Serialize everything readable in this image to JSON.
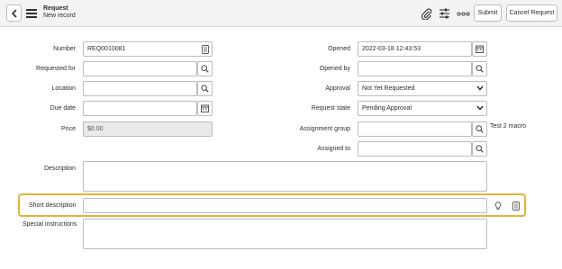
{
  "header": {
    "title": "Request",
    "subtitle": "New record",
    "icons": [
      "chevron-left-icon",
      "hamburger-menu-icon",
      "paperclip-icon",
      "sliders-icon",
      "more-ellipsis-icon"
    ],
    "submit_label": "Submit",
    "cancel_label": "Cancel Request"
  },
  "form": {
    "left": {
      "number": {
        "label": "Number",
        "value": "REQ0010081"
      },
      "requested_for": {
        "label": "Requested for",
        "value": ""
      },
      "location": {
        "label": "Location",
        "value": ""
      },
      "due_date": {
        "label": "Due date",
        "value": ""
      },
      "price": {
        "label": "Price",
        "value": "$0.00"
      }
    },
    "right": {
      "opened": {
        "label": "Opened",
        "value": "2022-03-18 12:43:53"
      },
      "opened_by": {
        "label": "Opened by",
        "value": ""
      },
      "approval": {
        "label": "Approval",
        "value": "Not Yet Requested"
      },
      "request_state": {
        "label": "Request state",
        "value": "Pending Approval"
      },
      "assignment_group": {
        "label": "Assignment group",
        "value": "",
        "note": "Test 2 macro"
      },
      "assigned_to": {
        "label": "Assigned to",
        "value": ""
      }
    },
    "description": {
      "label": "Description",
      "value": ""
    },
    "short_description": {
      "label": "Short description",
      "value": ""
    },
    "special_instructions": {
      "label": "Special instructions",
      "value": ""
    }
  },
  "colors": {
    "header_bg": "#f2f3f3",
    "border": "#b9bcbf",
    "highlight": "#e8b23a",
    "readonly_bg": "#e9eaea"
  }
}
